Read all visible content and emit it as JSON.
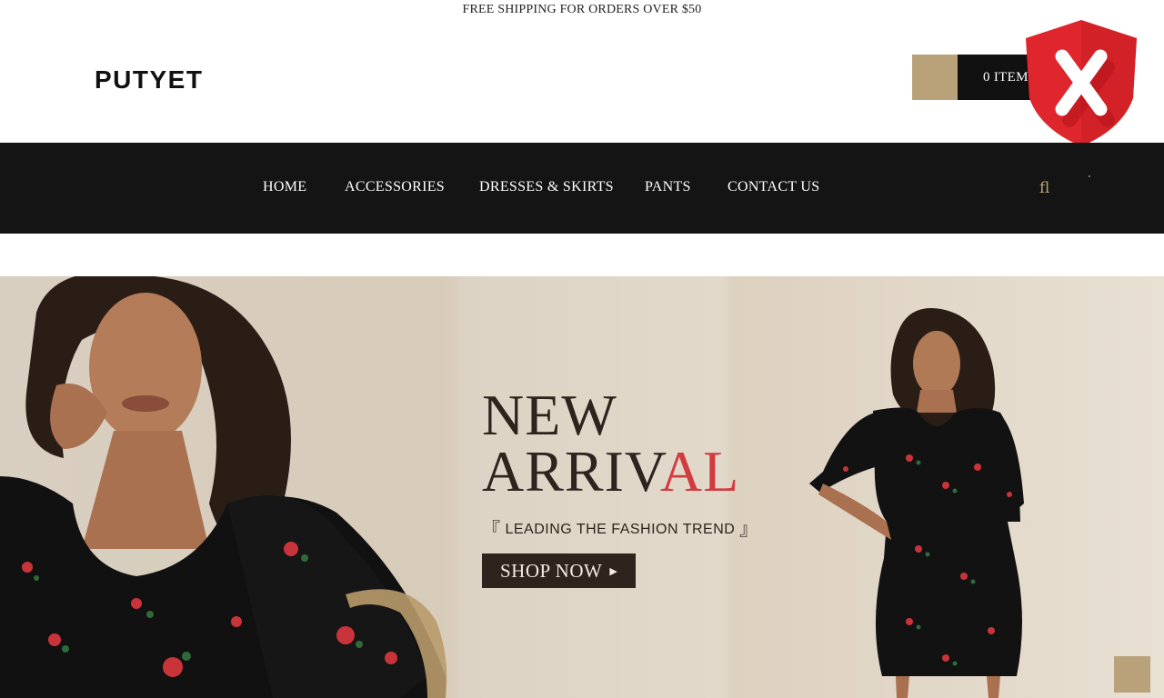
{
  "topbar": {
    "text": "FREE SHIPPING FOR ORDERS OVER $50"
  },
  "header": {
    "logo": "PUTYET",
    "cart_icon": "cart-icon",
    "cart_icon_glyph": "",
    "cart_label": "0 ITEMS"
  },
  "nav": {
    "items": [
      {
        "label": "HOME"
      },
      {
        "label": "ACCESSORIES"
      },
      {
        "label": "DRESSES & SKIRTS"
      },
      {
        "label": "PANTS"
      },
      {
        "label": "CONTACT US"
      }
    ],
    "search_icon": "search-icon",
    "search_glyph": "fl"
  },
  "hero": {
    "title_line1": "NEW",
    "title_line2_main": "ARRIV",
    "title_line2_accent": "AL",
    "tagline_open": "『",
    "tagline_text": "LEADING THE FASHION TREND",
    "tagline_close": "』",
    "button_label": "SHOP NOW",
    "button_icon": "play-triangle-icon",
    "button_icon_glyph": "▶"
  },
  "overlay": {
    "shield_icon": "shield-x-icon",
    "shield_letter": "X"
  },
  "scroll_top": {
    "icon": "arrow-up-icon",
    "glyph": ""
  },
  "colors": {
    "accent_gold": "#b9a27a",
    "nav_background": "#141414",
    "title_brown": "#2e231d",
    "title_red": "#d23b40",
    "shield_red": "#e0262d"
  }
}
